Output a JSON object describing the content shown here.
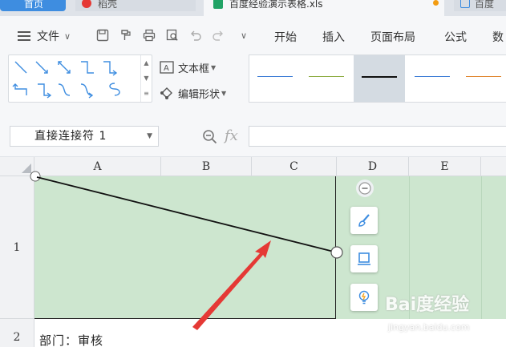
{
  "tabs": {
    "home": "首页",
    "daoke": "稻壳",
    "file": "百度经验演示表格.xls",
    "third": "百度"
  },
  "menu": {
    "file_label": "文件",
    "items": [
      "开始",
      "插入",
      "页面布局",
      "公式",
      "数"
    ]
  },
  "ribbon": {
    "textbox_label": "文本框",
    "edit_shape_label": "编辑形状",
    "line_colors": [
      "#3a7bd5",
      "#8bab3e",
      "#111111",
      "#3a7bd5",
      "#e0852e"
    ]
  },
  "formula": {
    "name_box": "直接连接符 1",
    "fx": "fx",
    "value": ""
  },
  "columns": [
    "A",
    "B",
    "C",
    "D",
    "E"
  ],
  "rows": [
    "1",
    "2"
  ],
  "cells": {
    "a2": "部门：审核"
  },
  "colors": {
    "cell_fill": "#cde6cf",
    "accent": "#3e8de0",
    "arrow": "#e53935"
  },
  "watermark": {
    "brand": "Bai度经验",
    "url": "jingyan.baidu.com"
  }
}
